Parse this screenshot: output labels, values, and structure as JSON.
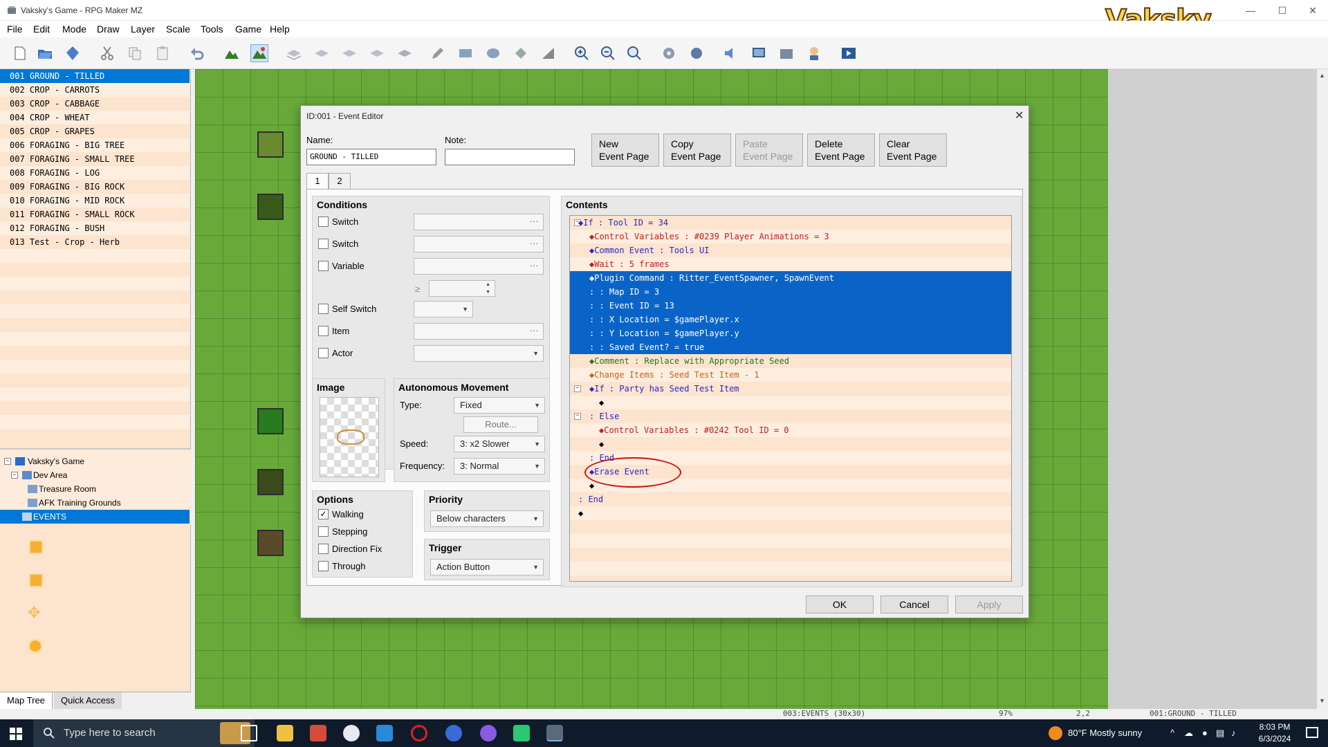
{
  "window": {
    "title": "Vaksky's Game - RPG Maker MZ",
    "logo": "Vaksky"
  },
  "menu": [
    "File",
    "Edit",
    "Mode",
    "Draw",
    "Layer",
    "Scale",
    "Tools",
    "Game",
    "Help"
  ],
  "events_list": [
    "001 GROUND - TILLED",
    "002 CROP - CARROTS",
    "003 CROP - CABBAGE",
    "004 CROP - WHEAT",
    "005 CROP - GRAPES",
    "006 FORAGING - BIG TREE",
    "007 FORAGING - SMALL TREE",
    "008 FORAGING - LOG",
    "009 FORAGING - BIG ROCK",
    "010 FORAGING - MID ROCK",
    "011 FORAGING - SMALL ROCK",
    "012 FORAGING - BUSH",
    "013 Test - Crop - Herb"
  ],
  "map_tree": {
    "root": "Vaksky's Game",
    "folder": "Dev Area",
    "items": [
      "Treasure Room",
      "AFK Training Grounds",
      "EVENTS"
    ]
  },
  "bottom_tabs": {
    "map_tree": "Map Tree",
    "quick_access": "Quick Access"
  },
  "status": {
    "map": "003:EVENTS (30x30)",
    "zoom": "97%",
    "coords": "2,2",
    "event": "001:GROUND - TILLED"
  },
  "dialog": {
    "title": "ID:001 - Event Editor",
    "name_label": "Name:",
    "name_value": "GROUND - TILLED",
    "note_label": "Note:",
    "note_value": "",
    "buttons": {
      "new": [
        "New",
        "Event Page"
      ],
      "copy": [
        "Copy",
        "Event Page"
      ],
      "paste": [
        "Paste",
        "Event Page"
      ],
      "delete": [
        "Delete",
        "Event Page"
      ],
      "clear": [
        "Clear",
        "Event Page"
      ]
    },
    "tabs": [
      "1",
      "2"
    ],
    "conditions": {
      "title": "Conditions",
      "switch1": "Switch",
      "switch2": "Switch",
      "variable": "Variable",
      "gte": "≥",
      "self_switch": "Self Switch",
      "item": "Item",
      "actor": "Actor"
    },
    "image": {
      "title": "Image"
    },
    "autonomous": {
      "title": "Autonomous Movement",
      "type_label": "Type:",
      "type_value": "Fixed",
      "route": "Route...",
      "speed_label": "Speed:",
      "speed_value": "3: x2 Slower",
      "freq_label": "Frequency:",
      "freq_value": "3: Normal"
    },
    "options": {
      "title": "Options",
      "walking": "Walking",
      "stepping": "Stepping",
      "direction_fix": "Direction Fix",
      "through": "Through"
    },
    "priority": {
      "title": "Priority",
      "value": "Below characters"
    },
    "trigger": {
      "title": "Trigger",
      "value": "Action Button"
    },
    "contents_title": "Contents",
    "contents": [
      {
        "ind": 12,
        "text": "◆If : Tool ID = 34",
        "color": "blue",
        "fold": "−"
      },
      {
        "ind": 28,
        "text": "◆Control Variables : #0239 Player Animations = 3",
        "color": "red"
      },
      {
        "ind": 28,
        "text": "◆Common Event : Tools UI",
        "color": "blue"
      },
      {
        "ind": 28,
        "text": "◆Wait : 5 frames",
        "color": "red"
      },
      {
        "ind": 28,
        "text": "◆Plugin Command : Ritter_EventSpawner, SpawnEvent",
        "color": "black",
        "sel": true
      },
      {
        "ind": 28,
        "text": " :                    : Map ID = 3",
        "color": "black",
        "sel": true
      },
      {
        "ind": 28,
        "text": " :                    : Event ID = 13",
        "color": "black",
        "sel": true
      },
      {
        "ind": 28,
        "text": " :                    : X Location = $gamePlayer.x",
        "color": "black",
        "sel": true
      },
      {
        "ind": 28,
        "text": " :                    : Y Location = $gamePlayer.y",
        "color": "black",
        "sel": true
      },
      {
        "ind": 28,
        "text": " :                    : Saved Event? = true",
        "color": "black",
        "sel": true
      },
      {
        "ind": 28,
        "text": "◆Comment : Replace with Appropriate Seed",
        "color": "green"
      },
      {
        "ind": 28,
        "text": "◆Change Items : Seed Test Item - 1",
        "color": "orange"
      },
      {
        "ind": 28,
        "text": "◆If : Party has Seed Test Item",
        "color": "blue",
        "fold": "−"
      },
      {
        "ind": 42,
        "text": "◆",
        "color": "black"
      },
      {
        "ind": 28,
        "text": " : Else",
        "color": "blue",
        "fold": "−"
      },
      {
        "ind": 42,
        "text": "◆Control Variables : #0242 Tool ID = 0",
        "color": "red"
      },
      {
        "ind": 42,
        "text": "◆",
        "color": "black"
      },
      {
        "ind": 28,
        "text": " : End",
        "color": "blue"
      },
      {
        "ind": 28,
        "text": "◆Erase Event",
        "color": "blue"
      },
      {
        "ind": 28,
        "text": "◆",
        "color": "black"
      },
      {
        "ind": 12,
        "text": " : End",
        "color": "blue"
      },
      {
        "ind": 12,
        "text": "◆",
        "color": "black"
      }
    ],
    "footer": {
      "ok": "OK",
      "cancel": "Cancel",
      "apply": "Apply"
    }
  },
  "taskbar": {
    "search_placeholder": "Type here to search",
    "weather": "80°F  Mostly sunny",
    "time": "8:03 PM",
    "date": "6/3/2024"
  },
  "colors": {
    "accent": "#0078d7",
    "list_bg": "#fde4cf",
    "map_grass": "#69a93a"
  }
}
